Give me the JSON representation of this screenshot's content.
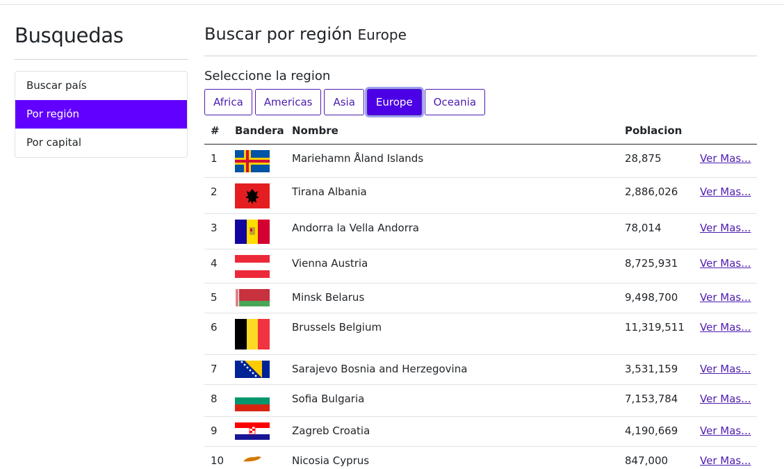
{
  "sidebar": {
    "title": "Busquedas",
    "items": [
      {
        "label": "Buscar país"
      },
      {
        "label": "Por región"
      },
      {
        "label": "Por capital"
      }
    ]
  },
  "main": {
    "title": "Buscar por región",
    "region": "Europe",
    "subtitle": "Seleccione la region",
    "buttons": [
      "Africa",
      "Americas",
      "Asia",
      "Europe",
      "Oceania"
    ],
    "active_button": "Europe"
  },
  "table": {
    "headers": {
      "num": "#",
      "flag": "Bandera",
      "name": "Nombre",
      "pop": "Poblacion"
    },
    "link_label": "Ver Mas...",
    "rows": [
      {
        "num": "1",
        "name": "Mariehamn Åland Islands",
        "pop": "28,875",
        "flag": "aland"
      },
      {
        "num": "2",
        "name": "Tirana Albania",
        "pop": "2,886,026",
        "flag": "albania"
      },
      {
        "num": "3",
        "name": "Andorra la Vella Andorra",
        "pop": "78,014",
        "flag": "andorra"
      },
      {
        "num": "4",
        "name": "Vienna Austria",
        "pop": "8,725,931",
        "flag": "austria"
      },
      {
        "num": "5",
        "name": "Minsk Belarus",
        "pop": "9,498,700",
        "flag": "belarus"
      },
      {
        "num": "6",
        "name": "Brussels Belgium",
        "pop": "11,319,511",
        "flag": "belgium"
      },
      {
        "num": "7",
        "name": "Sarajevo Bosnia and Herzegovina",
        "pop": "3,531,159",
        "flag": "bosnia"
      },
      {
        "num": "8",
        "name": "Sofia Bulgaria",
        "pop": "7,153,784",
        "flag": "bulgaria"
      },
      {
        "num": "9",
        "name": "Zagreb Croatia",
        "pop": "4,190,669",
        "flag": "croatia"
      },
      {
        "num": "10",
        "name": "Nicosia Cyprus",
        "pop": "847,000",
        "flag": "cyprus"
      }
    ]
  }
}
